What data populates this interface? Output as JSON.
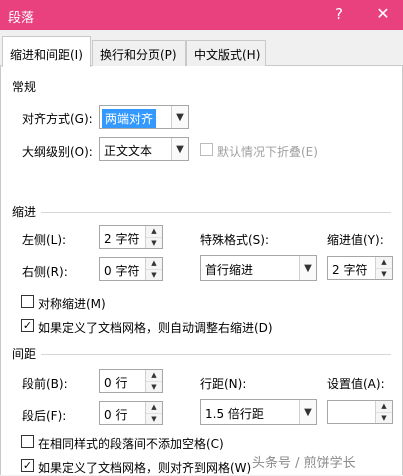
{
  "dialog": {
    "title": "段落",
    "help_label": "?",
    "close_label": "✕"
  },
  "tabs": [
    {
      "label": "缩进和间距(I)",
      "active": true
    },
    {
      "label": "换行和分页(P)",
      "active": false
    },
    {
      "label": "中文版式(H)",
      "active": false
    }
  ],
  "general": {
    "heading": "常规",
    "alignment_label": "对齐方式(G):",
    "alignment_value": "两端对齐",
    "outline_label": "大纲级别(O):",
    "outline_value": "正文文本",
    "collapse_label": "默认情况下折叠(E)",
    "collapse_checked": false
  },
  "indent": {
    "heading": "缩进",
    "left_label": "左侧(L):",
    "left_value": "2 字符",
    "right_label": "右侧(R):",
    "right_value": "0 字符",
    "special_label": "特殊格式(S):",
    "special_value": "首行缩进",
    "by_label": "缩进值(Y):",
    "by_value": "2 字符",
    "mirror_label": "对称缩进(M)",
    "mirror_checked": false,
    "auto_adjust_label": "如果定义了文档网格，则自动调整右缩进(D)",
    "auto_adjust_checked": true
  },
  "spacing": {
    "heading": "间距",
    "before_label": "段前(B):",
    "before_value": "0 行",
    "after_label": "段后(F):",
    "after_value": "0 行",
    "line_label": "行距(N):",
    "line_value": "1.5 倍行距",
    "at_label": "设置值(A):",
    "at_value": "",
    "no_space_label": "在相同样式的段落间不添加空格(C)",
    "no_space_checked": false,
    "snap_grid_label": "如果定义了文档网格，则对齐到网格(W)",
    "snap_grid_checked": true
  },
  "watermark": "头条号 / 煎饼学长",
  "icons": {
    "dropdown": "chevron-down-icon",
    "spin_up": "caret-up-icon",
    "spin_down": "caret-down-icon",
    "check": "checkmark-icon"
  }
}
